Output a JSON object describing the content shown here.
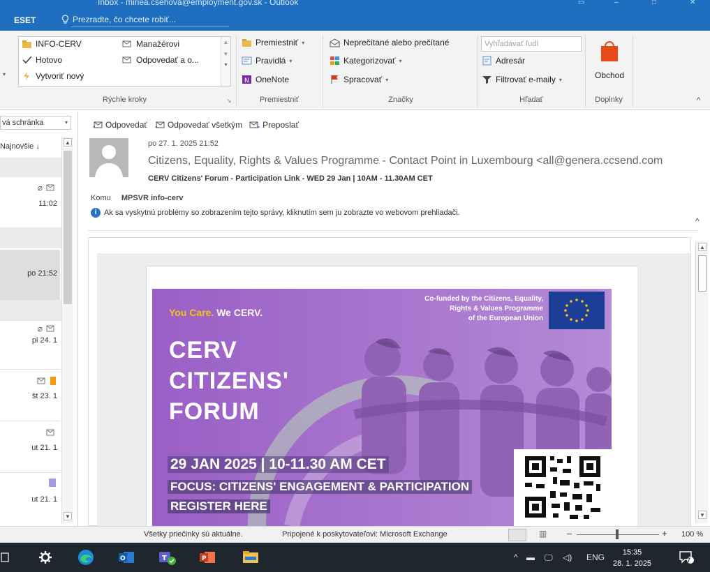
{
  "window": {
    "title": "Inbox - miriea.csehova@employment.gov.sk - Outlook"
  },
  "tell_bar": {
    "eset": "ESET",
    "tell_me": "Prezradte, čo chcete robiť..."
  },
  "ribbon": {
    "quick_steps": {
      "items": [
        "INFO-CERV",
        "Manažérovi",
        "Hotovo",
        "Odpovedať a o...",
        "Vytvoriť nový"
      ],
      "label": "Rýchle kroky"
    },
    "move": {
      "items": [
        "Premiestniť",
        "Pravidlá",
        "OneNote"
      ],
      "label": "Premiestniť"
    },
    "tags": {
      "items": [
        "Neprečítané alebo prečítané",
        "Kategorizovať",
        "Spracovať"
      ],
      "label": "Značky"
    },
    "find": {
      "search_placeholder": "Vyhľadávať ľudí",
      "items": [
        "Adresár",
        "Filtrovať e-maily"
      ],
      "label": "Hľadať"
    },
    "addins": {
      "store": "Obchod",
      "label": "Doplnky"
    },
    "colors": {
      "store_icon": "#e64a19",
      "flag": "#d9381e",
      "category": "#f39c12"
    }
  },
  "list_pane": {
    "mailbox": "vá schránka",
    "sort": "Najnovšie ↓",
    "items": [
      {
        "date": "11:02"
      },
      {
        "date": "po 21:52"
      },
      {
        "date": "pi 24. 1"
      },
      {
        "date": "št 23. 1"
      },
      {
        "date": "ut 21. 1"
      },
      {
        "date": "ut 21. 1"
      }
    ]
  },
  "reading_pane": {
    "actions": [
      "Odpovedať",
      "Odpovedať všetkým",
      "Preposlať"
    ],
    "date": "po 27. 1. 2025 21:52",
    "from": "Citizens, Equality, Rights & Values Programme - Contact Point in Luxembourg <all@genera.ccsend.com",
    "subject": "CERV Citizens' Forum - Participation Link - WED 29 Jan  | 10AM - 11.30AM CET",
    "to_label": "Komu",
    "to": "MPSVR info-cerv",
    "info": "Ak sa vyskytnú problémy so zobrazením tejto správy, kliknutím sem ju zobrazte vo webovom prehliadači."
  },
  "banner": {
    "you_care": "You Care.",
    "we_cerv": "We CERV.",
    "cofunded": [
      "Co-funded by the Citizens, Equality,",
      "Rights & Values Programme",
      "of the European Union"
    ],
    "title": [
      "CERV",
      "CITIZENS'",
      "FORUM"
    ],
    "date_line": "29 JAN 2025  |  10-11.30 AM CET",
    "focus": "FOCUS: CITIZENS' ENGAGEMENT & PARTICIPATION",
    "register": "REGISTER HERE",
    "colors": {
      "bg": "#9a5fc6",
      "accent": "#f5c316",
      "eu_blue": "#1d3e97"
    }
  },
  "status_bar": {
    "folders": "Všetky priečinky sú aktuálne.",
    "connected": "Pripojené k poskytovateľovi: Microsoft Exchange",
    "zoom": "100 %"
  },
  "taskbar": {
    "lang": "ENG",
    "time": "15:35",
    "date": "28. 1. 2025",
    "notifications": "7"
  }
}
